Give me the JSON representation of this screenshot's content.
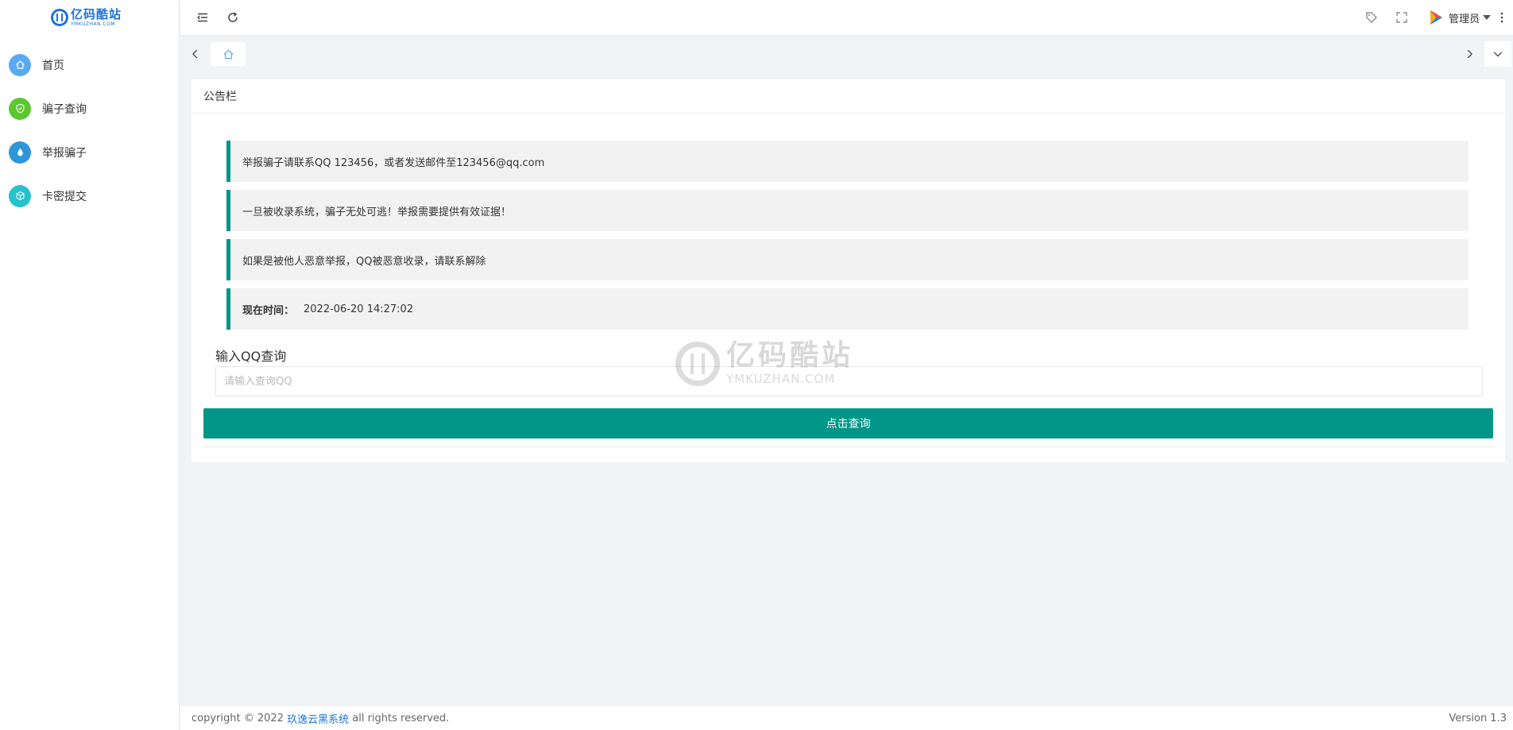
{
  "logo": {
    "cn": "亿码酷站",
    "en": "YMKUZHAN.COM"
  },
  "sidebar": {
    "items": [
      {
        "label": "首页",
        "color": "#5aa9f5"
      },
      {
        "label": "骗子查询",
        "color": "#5ac72e"
      },
      {
        "label": "举报骗子",
        "color": "#2d97d8"
      },
      {
        "label": "卡密提交",
        "color": "#27c2cf"
      }
    ]
  },
  "header": {
    "user_name": "管理员"
  },
  "card": {
    "title": "公告栏",
    "notices": [
      "举报骗子请联系QQ 123456，或者发送邮件至123456@qq.com",
      "一旦被收录系统，骗子无处可逃！举报需要提供有效证据！",
      "如果是被他人恶意举报，QQ被恶意收录，请联系解除"
    ],
    "time_label": "现在时间：",
    "time_value": "2022-06-20 14:27:02",
    "input_label": "输入QQ查询",
    "input_placeholder": "请输入查询QQ",
    "submit_label": "点击查询"
  },
  "watermark": {
    "cn": "亿码酷站",
    "en": "YMKUZHAN.COM"
  },
  "footer": {
    "prefix": "copyright © 2022 ",
    "link": "玖逸云黑系统",
    "suffix": " all rights reserved.",
    "version": "Version 1.3"
  },
  "colors": {
    "accent": "#009688",
    "link": "#1e73d8"
  }
}
